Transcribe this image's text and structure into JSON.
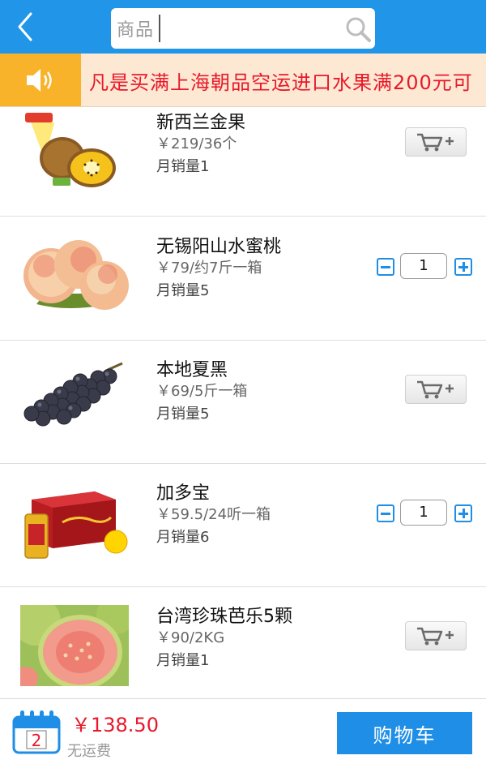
{
  "header": {
    "search_placeholder": "商品",
    "back_icon": "chevron-left-icon",
    "search_icon": "magnifier-icon"
  },
  "notice": {
    "icon": "speaker-icon",
    "text": "凡是买满上海朝品空运进口水果满200元可"
  },
  "products": [
    {
      "name": "新西兰金果",
      "price": "￥219/36个",
      "sales": "月销量1",
      "action": "add-to-cart",
      "image": "kiwi"
    },
    {
      "name": "无锡阳山水蜜桃",
      "price": "￥79/约7斤一箱",
      "sales": "月销量5",
      "action": "quantity",
      "qty": "1",
      "image": "peach"
    },
    {
      "name": "本地夏黑",
      "price": "￥69/5斤一箱",
      "sales": "月销量5",
      "action": "add-to-cart",
      "image": "grapes"
    },
    {
      "name": "加多宝",
      "price": "￥59.5/24听一箱",
      "sales": "月销量6",
      "action": "quantity",
      "qty": "1",
      "image": "jiaduobao"
    },
    {
      "name": "台湾珍珠芭乐5颗",
      "price": "￥90/2KG",
      "sales": "月销量1",
      "action": "add-to-cart",
      "image": "guava"
    }
  ],
  "footer": {
    "cart_count": "2",
    "total": "￥138.50",
    "shipping": "无运费",
    "cart_button": "购物车"
  },
  "colors": {
    "primary": "#2196e8",
    "price_red": "#e8182a",
    "notice_bg": "#fde9d3",
    "speaker_bg": "#f8b32b"
  }
}
